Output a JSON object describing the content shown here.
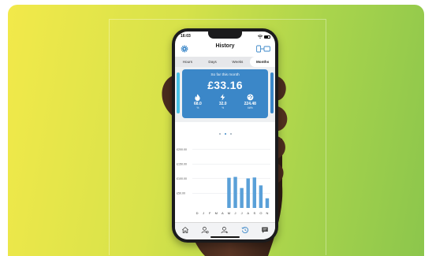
{
  "status_bar": {
    "time": "16:03"
  },
  "header": {
    "title": "History",
    "settings_icon": "gear-icon",
    "device_icon": "plug-device-icon"
  },
  "tabs": [
    {
      "label": "Hours",
      "active": false
    },
    {
      "label": "Days",
      "active": false
    },
    {
      "label": "Weeks",
      "active": false
    },
    {
      "label": "Months",
      "active": true
    }
  ],
  "summary_card": {
    "subtitle": "So far this month",
    "amount": "£33.16",
    "stats": [
      {
        "icon": "flame-icon",
        "value": "68.0",
        "unit": "%"
      },
      {
        "icon": "lightning-icon",
        "value": "32.0",
        "unit": "%"
      },
      {
        "icon": "gauge-icon",
        "value": "224.48",
        "unit": "kWh"
      }
    ]
  },
  "carousel": {
    "pages": 3,
    "active_page": 2
  },
  "chart_data": {
    "type": "bar",
    "categories": [
      "D",
      "J",
      "F",
      "M",
      "A",
      "M",
      "J",
      "J",
      "A",
      "S",
      "O",
      "N"
    ],
    "values": [
      0,
      0,
      0,
      0,
      0,
      103,
      106,
      68,
      101,
      104,
      77,
      33
    ],
    "y_tick_labels": [
      "£50.00",
      "£100.00",
      "£150.00",
      "£200.00"
    ],
    "y_ticks": [
      50,
      100,
      150,
      200
    ],
    "ylim": [
      0,
      215
    ],
    "bar_color": "#5aa0d8",
    "grid": true
  },
  "bottom_nav": [
    {
      "name": "home",
      "icon": "home-icon"
    },
    {
      "name": "account",
      "icon": "user-icon"
    },
    {
      "name": "profile",
      "icon": "user-settings-icon"
    },
    {
      "name": "history",
      "icon": "history-icon",
      "active": true
    },
    {
      "name": "messages",
      "icon": "chat-icon"
    }
  ],
  "colors": {
    "accent": "#3b87c8",
    "active_nav": "#3b87c8"
  }
}
